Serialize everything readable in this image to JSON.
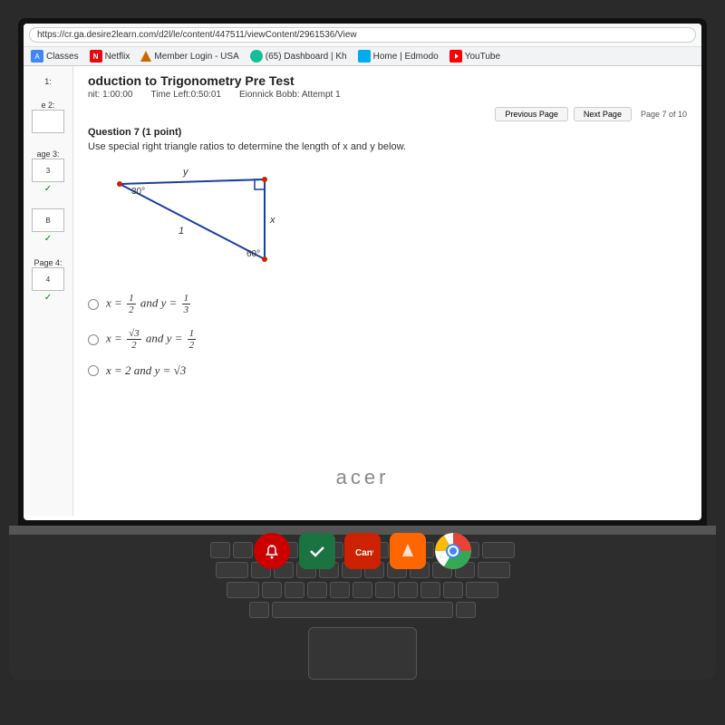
{
  "browser": {
    "address": "https://cr.ga.desire2learn.com/d2l/le/content/447511/viewContent/2961536/View",
    "bookmarks": [
      {
        "label": "Classes",
        "icon": "classes"
      },
      {
        "label": "Netflix",
        "icon": "netflix"
      },
      {
        "label": "Member Login - USA",
        "icon": "member"
      },
      {
        "label": "(65) Dashboard | Kh",
        "icon": "khanacademy"
      },
      {
        "label": "Home | Edmodo",
        "icon": "edmodo"
      },
      {
        "label": "YouTube",
        "icon": "youtube"
      }
    ]
  },
  "page": {
    "title": "oduction to Trigonometry Pre Test",
    "time_limit": "nit: 1:00:00",
    "time_left": "Time Left:0:50:01",
    "student": "Eionnick Bobb: Attempt 1",
    "page_indicator": "Page 7 of 10"
  },
  "sidebar": {
    "items": [
      {
        "label": "1:",
        "page": "1"
      },
      {
        "label": "e 2:",
        "page": "2"
      },
      {
        "label": "age 3:",
        "page": "3",
        "check": true
      },
      {
        "label": "",
        "page": "B",
        "check": true
      },
      {
        "label": "Page 4:",
        "page": "4",
        "check": true
      }
    ]
  },
  "question": {
    "number": "Question 7",
    "points": "(1 point)",
    "text": "Use special right triangle ratios to determine the length of x and y below.",
    "triangle": {
      "angle1": "30°",
      "angle2": "60°",
      "side1": "1",
      "label_x": "x",
      "label_y": "y"
    },
    "answers": [
      {
        "id": "a",
        "text_parts": [
          "x = ",
          "1/2",
          " and y = ",
          "1/3"
        ]
      },
      {
        "id": "b",
        "text_parts": [
          "x = ",
          "√3/2",
          " and y = ",
          "1/2"
        ]
      },
      {
        "id": "c",
        "text_parts": [
          "x = 2 and y = ",
          "√3"
        ]
      }
    ]
  },
  "nav": {
    "prev_label": "Previous Page",
    "next_label": "Next Page"
  },
  "acer_logo": "acer",
  "dock": {
    "icons": [
      "notification",
      "checkmark",
      "canvas",
      "paw",
      "chrome"
    ]
  }
}
